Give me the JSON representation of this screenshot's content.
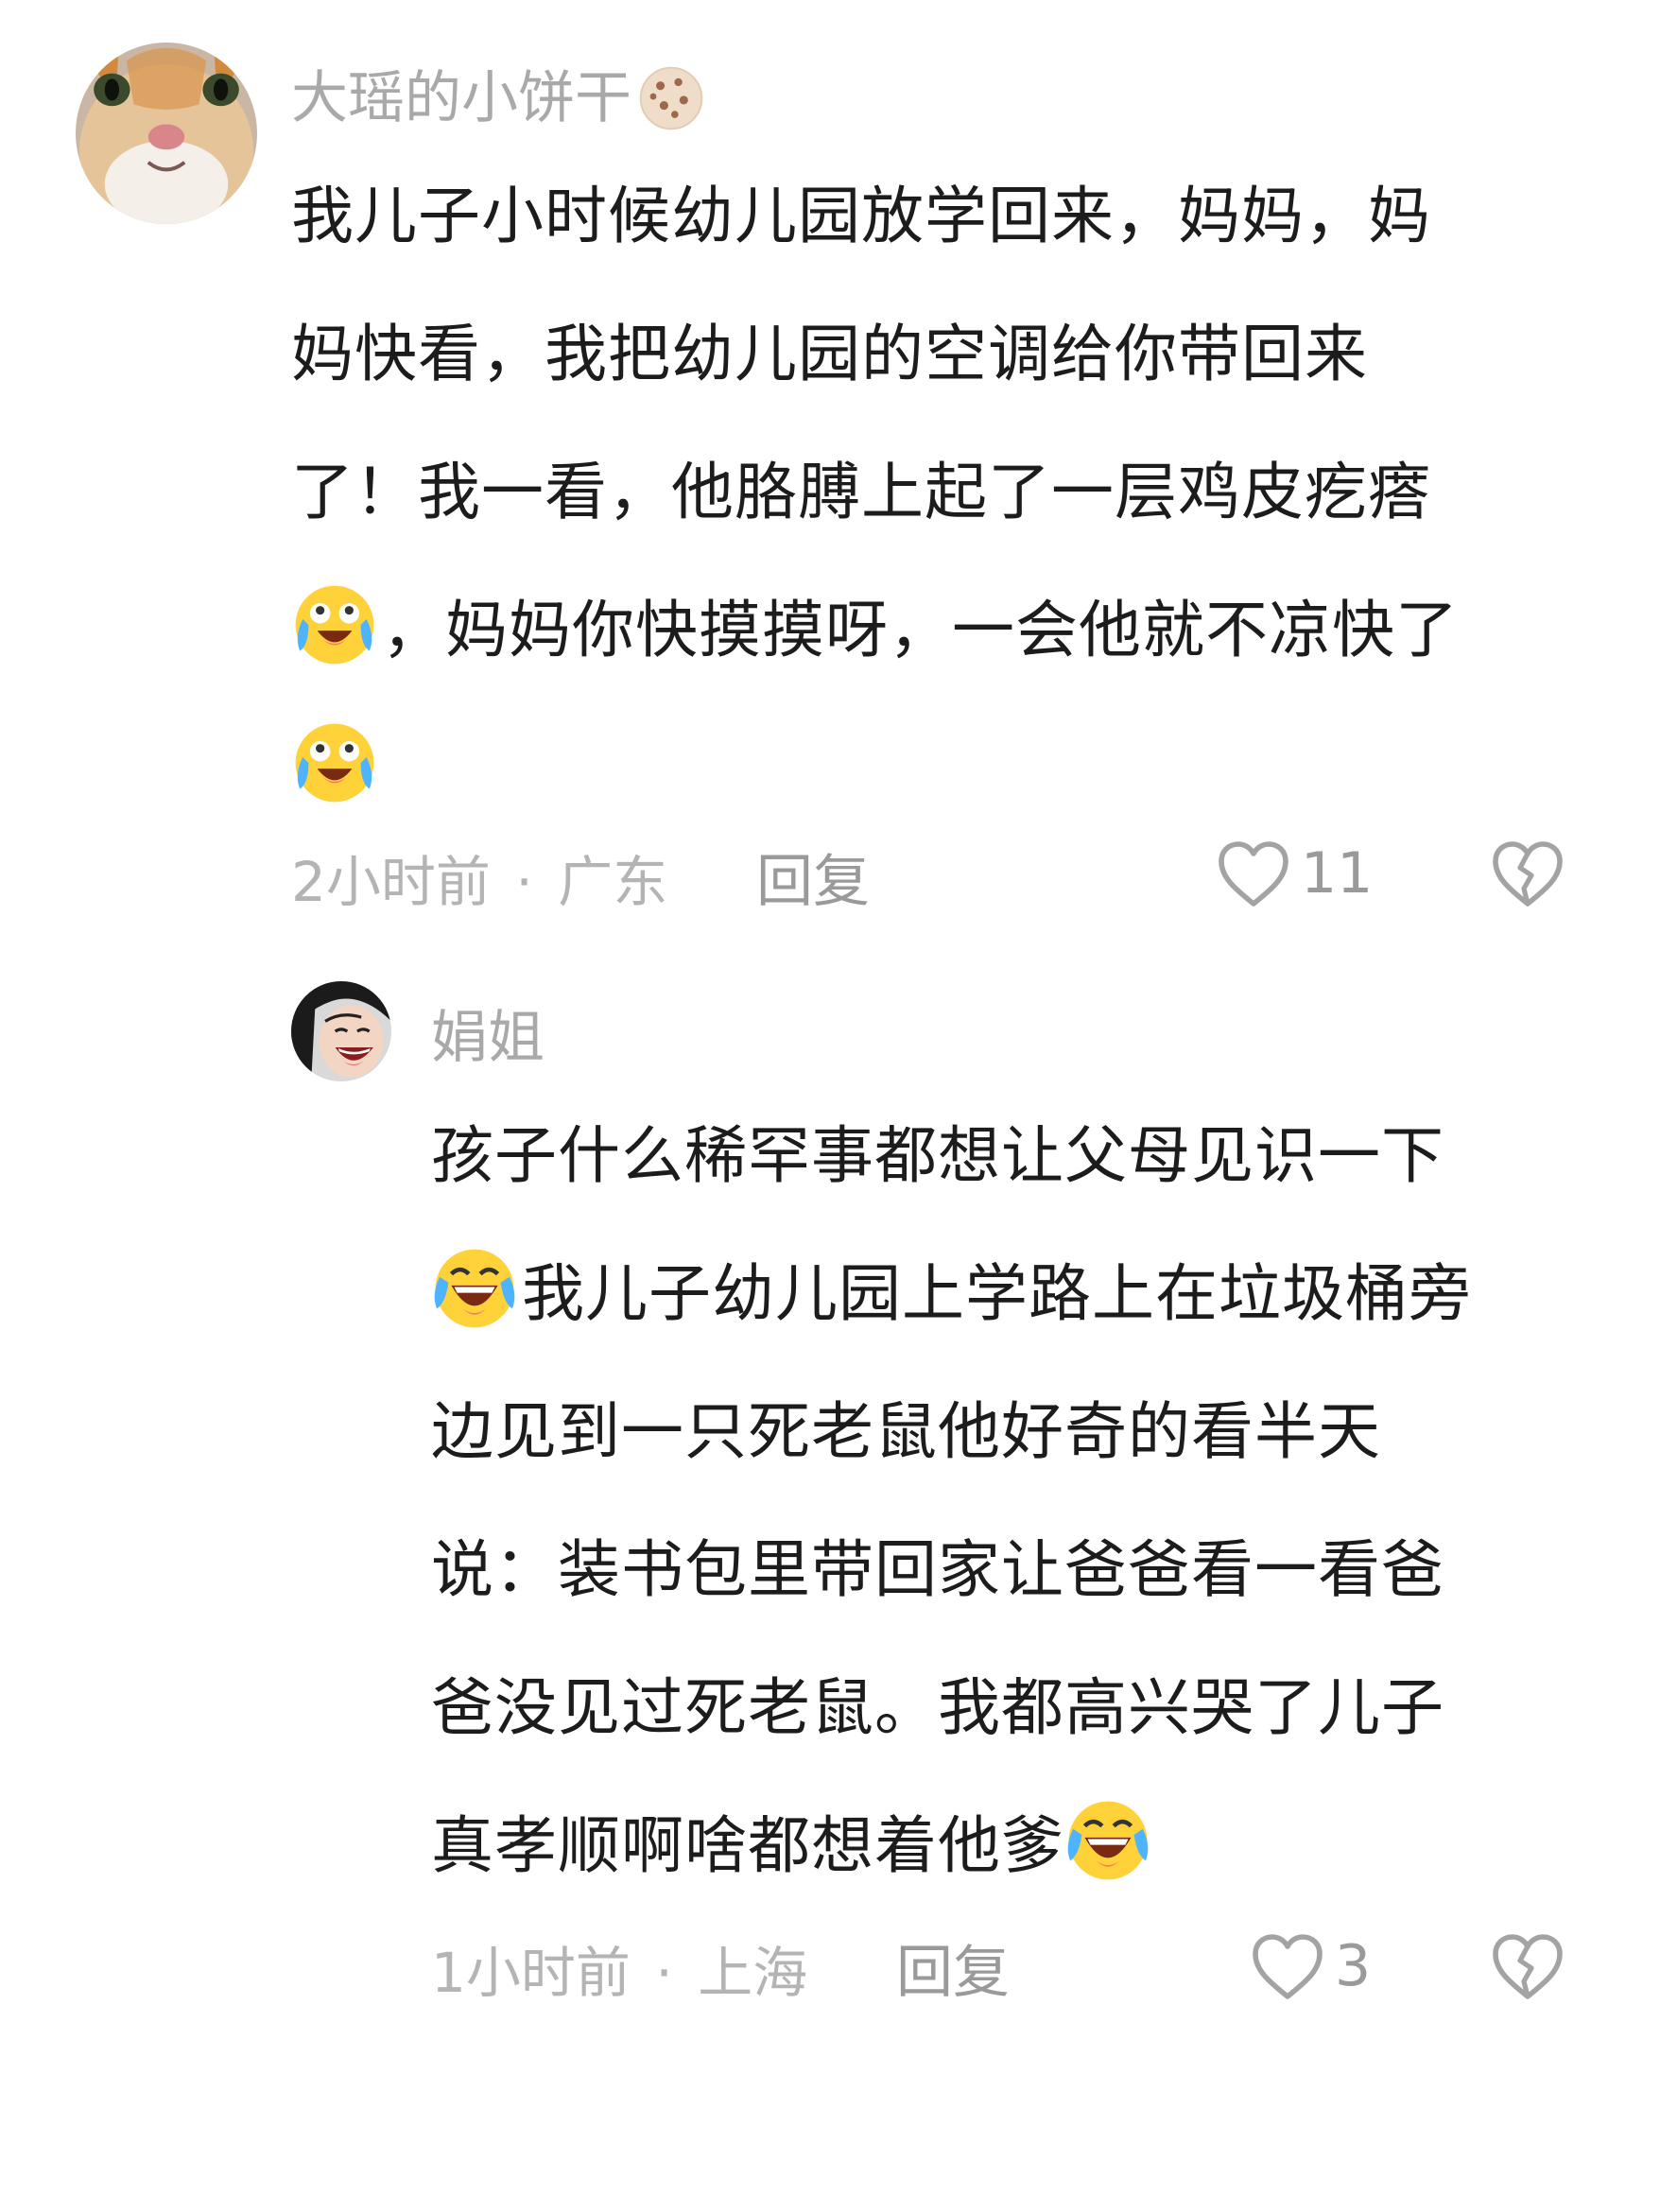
{
  "comments": [
    {
      "username": "大瑶的小饼干",
      "username_icon": "cookie-icon",
      "avatar": "cat-avatar",
      "text_lines": [
        [
          {
            "t": "我儿子小时候幼儿园放学回来，妈妈，妈"
          }
        ],
        [
          {
            "t": "妈快看，我把幼儿园的空调给你带回来"
          }
        ],
        [
          {
            "t": "了！我一看，他胳膊上起了一层鸡皮疙瘩"
          }
        ],
        [
          {
            "emoji": "crying-laugh-icon"
          },
          {
            "t": "，妈妈你快摸摸呀，一会他就不凉快了"
          }
        ],
        [
          {
            "emoji": "crying-laugh-icon"
          }
        ]
      ],
      "time": "2小时前",
      "location": "广东",
      "meta_separator": "·",
      "reply_label": "回复",
      "likes": "11"
    },
    {
      "username": "娟姐",
      "avatar": "laughing-woman-avatar",
      "text_lines": [
        [
          {
            "t": "孩子什么稀罕事都想让父母见识一下"
          }
        ],
        [
          {
            "emoji": "rolling-laugh-icon"
          },
          {
            "t": "我儿子幼儿园上学路上在垃圾桶旁"
          }
        ],
        [
          {
            "t": "边见到一只死老鼠他好奇的看半天"
          }
        ],
        [
          {
            "t": "说：装书包里带回家让爸爸看一看爸"
          }
        ],
        [
          {
            "t": "爸没见过死老鼠。我都高兴哭了儿子"
          }
        ],
        [
          {
            "t": "真孝顺啊啥都想着他爹"
          },
          {
            "emoji": "rolling-laugh-icon"
          }
        ]
      ],
      "time": "1小时前",
      "location": "上海",
      "meta_separator": "·",
      "reply_label": "回复",
      "likes": "3"
    }
  ],
  "colors": {
    "username": "#a9a9a9",
    "text": "#1c1c1c",
    "meta": "#b4b4b4",
    "action": "#9a9a9a"
  }
}
